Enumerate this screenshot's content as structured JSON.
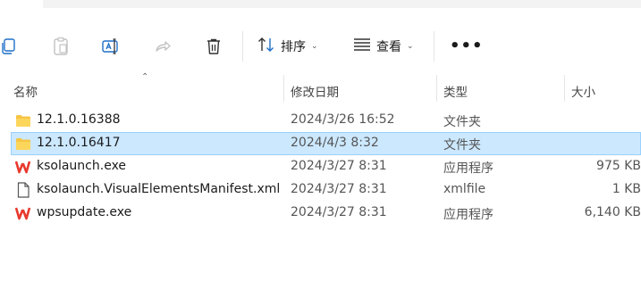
{
  "toolbar": {
    "sort_label": "排序",
    "view_label": "查看",
    "more_label": "•••"
  },
  "columns": {
    "name": "名称",
    "modified": "修改日期",
    "type": "类型",
    "size": "大小"
  },
  "files": [
    {
      "name": "12.1.0.16388",
      "modified": "2024/3/26 16:52",
      "type": "文件夹",
      "size": "",
      "icon": "folder-icon"
    },
    {
      "name": "12.1.0.16417",
      "modified": "2024/4/3 8:32",
      "type": "文件夹",
      "size": "",
      "icon": "folder-icon",
      "selected": true
    },
    {
      "name": "ksolaunch.exe",
      "modified": "2024/3/27 8:31",
      "type": "应用程序",
      "size": "975 KB",
      "icon": "wps-app-icon"
    },
    {
      "name": "ksolaunch.VisualElementsManifest.xml",
      "modified": "2024/3/27 8:31",
      "type": "xmlfile",
      "size": "1 KB",
      "icon": "document-icon"
    },
    {
      "name": "wpsupdate.exe",
      "modified": "2024/3/27 8:31",
      "type": "应用程序",
      "size": "6,140 KB",
      "icon": "wps-app-icon"
    }
  ],
  "colors": {
    "selection_bg": "#cce8ff",
    "selection_border": "#99d1ff",
    "folder": "#f6c544",
    "wps_red": "#e8392e"
  }
}
